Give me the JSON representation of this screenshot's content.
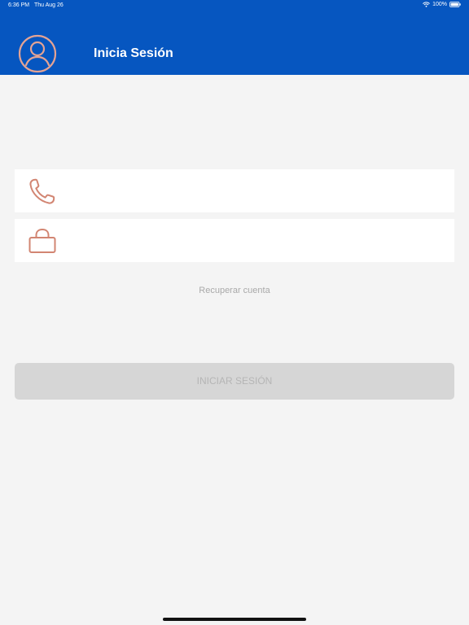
{
  "status_bar": {
    "time": "6:36 PM",
    "date": "Thu Aug 26",
    "battery": "100%",
    "wifi_icon": "wifi-icon",
    "battery_icon": "battery-icon"
  },
  "header": {
    "title": "Inicia Sesión",
    "avatar_icon": "user-circle-icon",
    "background_color": "#0656c0"
  },
  "form": {
    "phone_field": {
      "icon": "phone-icon",
      "value": "",
      "placeholder": ""
    },
    "password_field": {
      "icon": "lock-icon",
      "value": "",
      "placeholder": ""
    },
    "recover_label": "Recuperar cuenta",
    "submit_label": "INICIAR SESIÓN",
    "icon_color": "#d28572"
  }
}
